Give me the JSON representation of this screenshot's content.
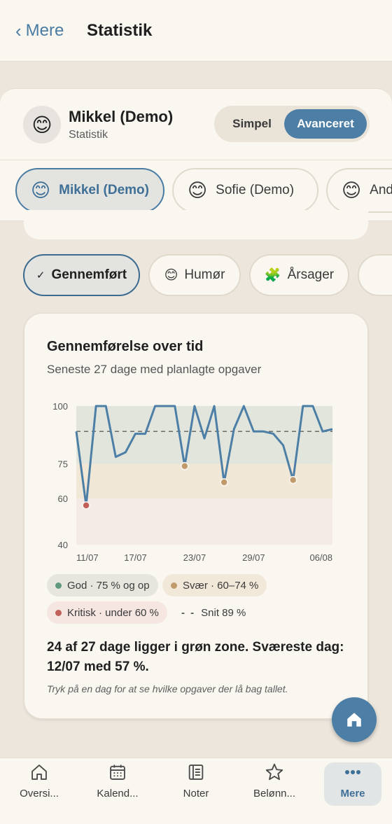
{
  "header": {
    "back_label": "Mere",
    "title": "Statistik"
  },
  "profile": {
    "emoji": "😊",
    "name": "Mikkel (Demo)",
    "subtitle": "Statistik"
  },
  "mode_toggle": {
    "options": [
      "Simpel",
      "Avanceret"
    ],
    "selected": "Avanceret"
  },
  "profiles": [
    {
      "emoji": "😊",
      "label": "Mikkel (Demo)",
      "active": true
    },
    {
      "emoji": "😊",
      "label": "Sofie (Demo)",
      "active": false
    },
    {
      "emoji": "😊",
      "label": "And",
      "active": false
    }
  ],
  "filters": [
    {
      "icon": "✓",
      "label": "Gennemført",
      "active": true
    },
    {
      "icon": "😊",
      "label": "Humør",
      "active": false
    },
    {
      "icon": "🧩",
      "label": "Årsager",
      "active": false
    }
  ],
  "card": {
    "title": "Gennemførelse over tid",
    "subtitle": "Seneste 27 dage med planlagte opgaver",
    "summary": "24 af 27 dage ligger i grøn zone. Sværeste dag: 12/07 med 57 %.",
    "hint": "Tryk på en dag for at se hvilke opgaver der lå bag tallet."
  },
  "legend": {
    "good": "God · 75 % og op",
    "hard": "Svær · 60–74 %",
    "critical": "Kritisk · under 60 %",
    "average": "Snit 89 %"
  },
  "colors": {
    "accent": "#4d7fa6",
    "zone_good": "#e1e5dc",
    "zone_hard": "#f1e7d6",
    "zone_critical": "#f5ebe6",
    "dot_good": "#5f9a7f",
    "dot_hard": "#c09a6b",
    "dot_critical": "#c2615a"
  },
  "chart_data": {
    "type": "line",
    "title": "Gennemførelse over tid",
    "x": [
      "11/07",
      "12/07",
      "13/07",
      "14/07",
      "15/07",
      "16/07",
      "17/07",
      "18/07",
      "19/07",
      "20/07",
      "21/07",
      "22/07",
      "23/07",
      "24/07",
      "25/07",
      "26/07",
      "27/07",
      "28/07",
      "29/07",
      "30/07",
      "31/07",
      "01/08",
      "02/08",
      "03/08",
      "04/08",
      "05/08",
      "06/08"
    ],
    "x_tick_labels": [
      "11/07",
      "17/07",
      "23/07",
      "29/07",
      "06/08"
    ],
    "series": [
      {
        "values": [
          89,
          57,
          100,
          100,
          78,
          80,
          88,
          88,
          100,
          100,
          100,
          74,
          100,
          86,
          100,
          67,
          90,
          100,
          89,
          89,
          88,
          83,
          68,
          100,
          100,
          89,
          90
        ]
      }
    ],
    "y_ticks": [
      40,
      60,
      75,
      100
    ],
    "ylim": [
      40,
      100
    ],
    "average": 89,
    "zones": [
      {
        "label": "God",
        "from": 75,
        "to": 100
      },
      {
        "label": "Svær",
        "from": 60,
        "to": 75
      },
      {
        "label": "Kritisk",
        "from": 40,
        "to": 60
      }
    ]
  },
  "fab": {
    "icon": "home-icon"
  },
  "bottom_nav": [
    {
      "icon": "home-icon",
      "label": "Oversi...",
      "active": false
    },
    {
      "icon": "calendar-icon",
      "label": "Kalend...",
      "active": false
    },
    {
      "icon": "notes-icon",
      "label": "Noter",
      "active": false
    },
    {
      "icon": "star-icon",
      "label": "Belønn...",
      "active": false
    },
    {
      "icon": "more-icon",
      "label": "Mere",
      "active": true
    }
  ]
}
